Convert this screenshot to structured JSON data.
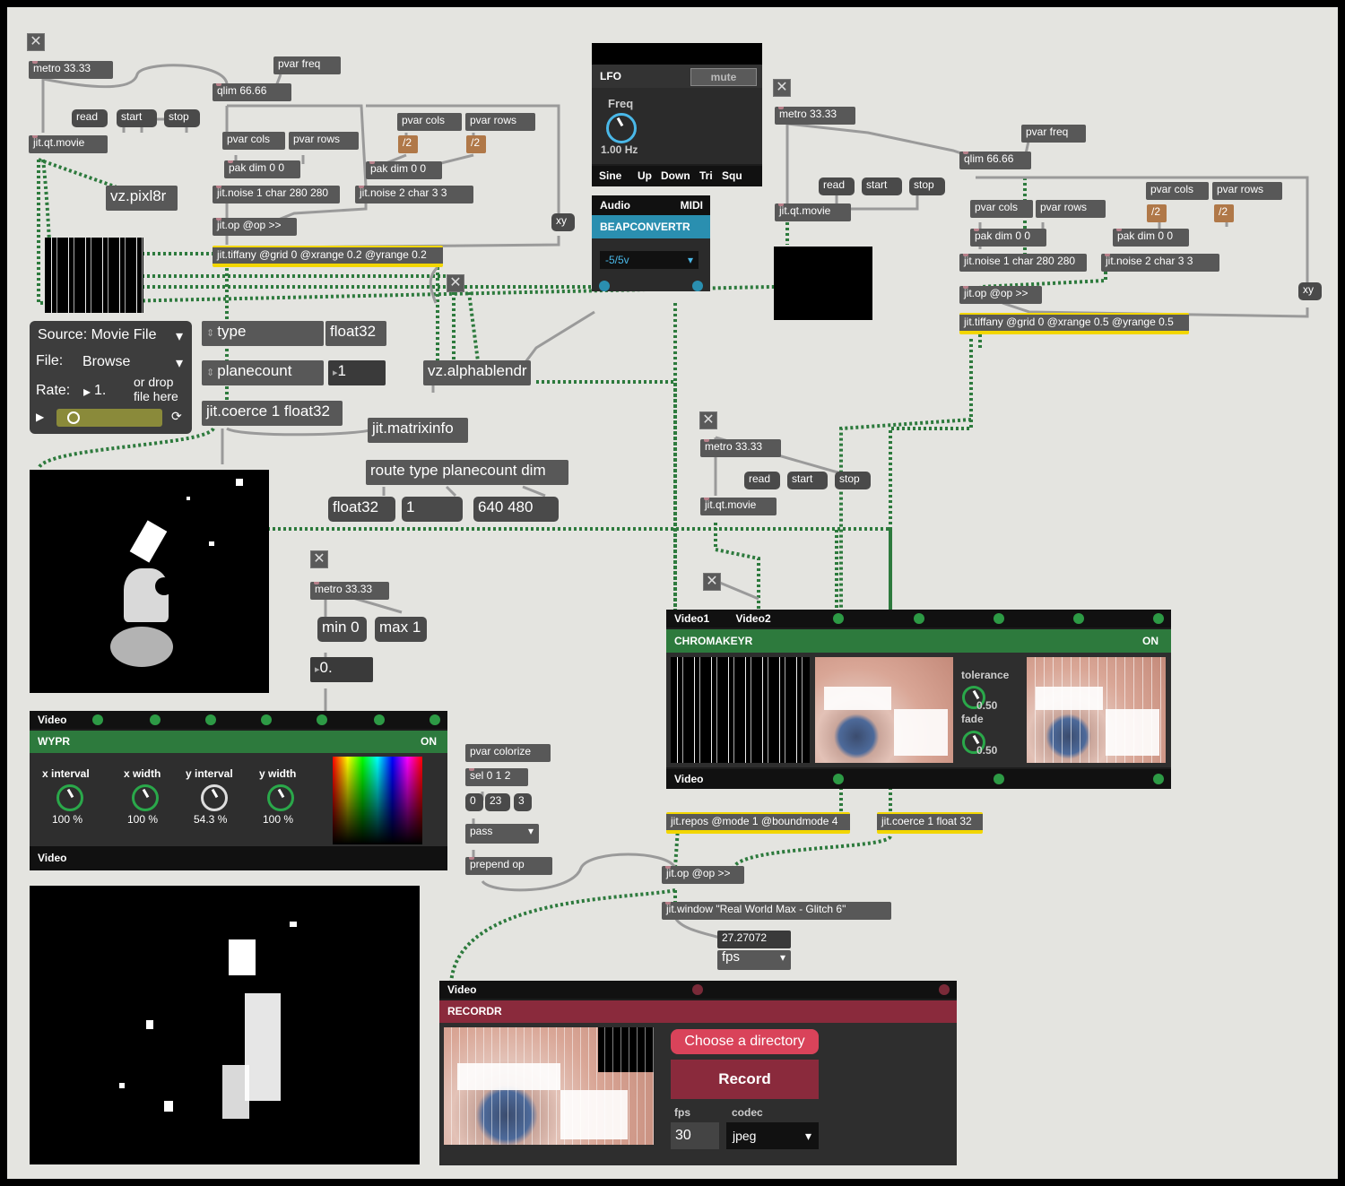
{
  "window": {
    "title": "Real World Max - Glitch 6"
  },
  "objects": {
    "metro_a": "metro 33.33",
    "pvar_freq_a": "pvar freq",
    "qlim_a": "qlim 66.66",
    "read_a": "read",
    "start_a": "start",
    "stop_a": "stop",
    "qtmovie_a": "jit.qt.movie",
    "pvar_cols_a": "pvar cols",
    "pvar_rows_a": "pvar rows",
    "pvar_cols_a2": "pvar cols",
    "pvar_rows_a2": "pvar rows",
    "div_a1": "/2",
    "div_a2": "/2",
    "pak_a1": "pak dim 0 0",
    "pak_a2": "pak dim 0 0",
    "vz_pixl8r": "vz.pixl8r",
    "noise_a1": "jit.noise 1 char 280 280",
    "noise_a2": "jit.noise 2 char 3 3",
    "op_a": "jit.op @op >>",
    "xy_a": "xy",
    "tiffany_a": "jit.tiffany @grid 0 @xrange 0.2 @yrange 0.2",
    "type_label": "type",
    "type_val": "float32",
    "planecount_label": "planecount",
    "planecount_val": "1",
    "coerce_a": "jit.coerce 1 float32",
    "alphablend": "vz.alphablendr",
    "matrixinfo": "jit.matrixinfo",
    "route": "route type planecount dim",
    "out_float32": "float32",
    "out_1": "1",
    "out_dim": "640 480",
    "metro_b": "metro 33.33",
    "min0": "min 0",
    "max1": "max 1",
    "num0": "0.",
    "metro_c": "metro 33.33",
    "read_c": "read",
    "start_c": "start",
    "stop_c": "stop",
    "qtmovie_c": "jit.qt.movie",
    "metro_d": "metro 33.33",
    "read_d": "read",
    "start_d": "start",
    "stop_d": "stop",
    "qtmovie_d": "jit.qt.movie",
    "pvar_freq_d": "pvar freq",
    "qlim_d": "qlim 66.66",
    "pvar_cols_d": "pvar cols",
    "pvar_rows_d": "pvar rows",
    "pvar_cols_d2": "pvar cols",
    "pvar_rows_d2": "pvar rows",
    "div_d1": "/2",
    "div_d2": "/2",
    "pak_d1": "pak dim 0 0",
    "pak_d2": "pak dim 0 0",
    "noise_d1": "jit.noise 1 char 280 280",
    "noise_d2": "jit.noise 2 char 3 3",
    "op_d": "jit.op @op >>",
    "xy_d": "xy",
    "tiffany_d": "jit.tiffany @grid 0 @xrange 0.5 @yrange 0.5",
    "pvar_colorize": "pvar colorize",
    "sel": "sel 0 1 2",
    "msg0": "0",
    "msg23": "23",
    "msg3": "3",
    "pass": "pass",
    "prepend": "prepend op",
    "repos": "jit.repos @mode 1 @boundmode 4",
    "coerce_e": "jit.coerce 1 float 32",
    "op_e": "jit.op @op >>",
    "window_obj": "jit.window \"Real World Max - Glitch 6\"",
    "fps_val": "27.27072",
    "fps_menu": "fps"
  },
  "source_panel": {
    "source_label": "Source:",
    "source_value": "Movie File",
    "file_label": "File:",
    "file_value": "Browse",
    "rate_label": "Rate:",
    "rate_value": "1.",
    "drop_hint": "or drop file here"
  },
  "lfo": {
    "title": "LFO",
    "mute": "mute",
    "freq_label": "Freq",
    "freq_value": "1.00 Hz",
    "waves": [
      "Sine",
      "Up",
      "Down",
      "Tri",
      "Squ"
    ]
  },
  "beapconvertr": {
    "audio": "Audio",
    "midi": "MIDI",
    "title": "BEAPCONVERTR",
    "range": "-5/5v"
  },
  "wypr": {
    "header": "Video",
    "title": "WYPR",
    "on": "ON",
    "x_interval_label": "x interval",
    "x_interval_value": "100 %",
    "x_width_label": "x width",
    "x_width_value": "100 %",
    "y_interval_label": "y interval",
    "y_interval_value": "54.3 %",
    "y_width_label": "y width",
    "y_width_value": "100 %",
    "footer": "Video"
  },
  "chromakeyr": {
    "video1": "Video1",
    "video2": "Video2",
    "title": "CHROMAKEYR",
    "on": "ON",
    "tolerance_label": "tolerance",
    "tolerance_value": "0.50",
    "fade_label": "fade",
    "fade_value": "0.50",
    "footer": "Video"
  },
  "recordr": {
    "header": "Video",
    "title": "RECORDR",
    "choose_dir": "Choose a directory",
    "record": "Record",
    "fps_label": "fps",
    "fps_value": "30",
    "codec_label": "codec",
    "codec_value": "jpeg"
  },
  "colors": {
    "canvas": "#e4e4e0",
    "object": "#585858",
    "cable_green": "#2d9a45",
    "highlight_yellow": "#f2d600",
    "recordr_red": "#8a2a3c",
    "choose_pink": "#d9435a"
  }
}
